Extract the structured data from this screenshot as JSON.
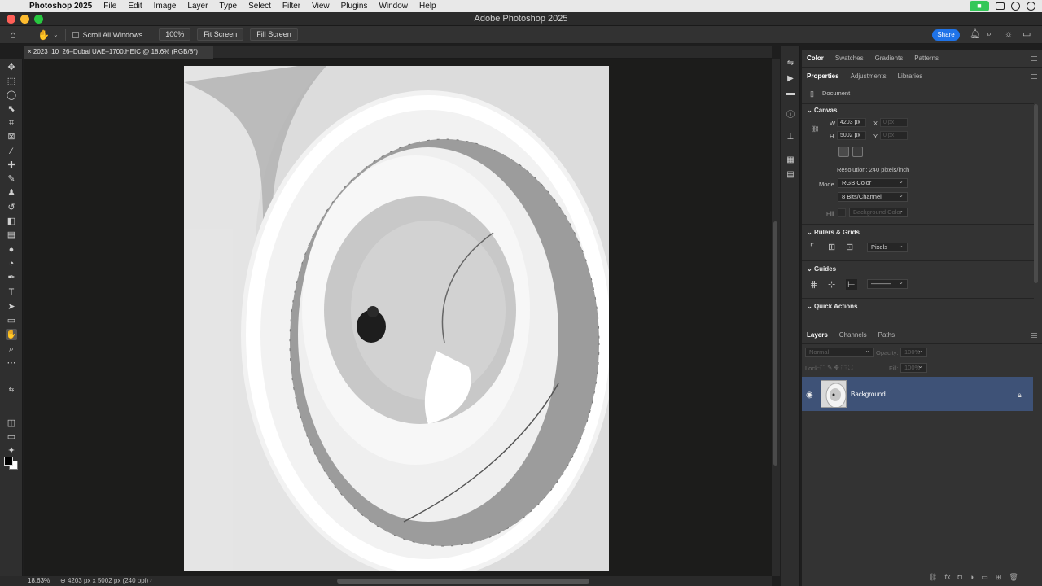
{
  "menubar": {
    "app_name": "Photoshop 2025",
    "items": [
      "File",
      "Edit",
      "Image",
      "Layer",
      "Type",
      "Select",
      "Filter",
      "View",
      "Plugins",
      "Window",
      "Help"
    ]
  },
  "window": {
    "title": "Adobe Photoshop 2025"
  },
  "options_bar": {
    "scroll_all_windows": "Scroll All Windows",
    "zoom_100": "100%",
    "fit_screen": "Fit Screen",
    "fill_screen": "Fill Screen",
    "share": "Share"
  },
  "document_tab": {
    "label": "2023_10_26–Dubai UAE–1700.HEIC @ 18.6% (RGB/8*)"
  },
  "color_panel": {
    "tabs": [
      "Color",
      "Swatches",
      "Gradients",
      "Patterns"
    ],
    "active": "Color"
  },
  "properties_panel": {
    "tabs": [
      "Properties",
      "Adjustments",
      "Libraries"
    ],
    "active": "Properties",
    "document_label": "Document",
    "canvas": {
      "title": "Canvas",
      "w_label": "W",
      "w_value": "4203 px",
      "h_label": "H",
      "h_value": "5002 px",
      "x_label": "X",
      "x_placeholder": "0 px",
      "y_label": "Y",
      "y_placeholder": "0 px",
      "resolution": "Resolution: 240 pixels/inch",
      "mode_label": "Mode",
      "mode_value": "RGB Color",
      "bits_value": "8 Bits/Channel",
      "fill_label": "Fill",
      "fill_value": "Background Color"
    },
    "rulers_grids": {
      "title": "Rulers & Grids",
      "units": "Pixels"
    },
    "guides": {
      "title": "Guides"
    },
    "quick_actions": {
      "title": "Quick Actions"
    }
  },
  "layers_panel": {
    "tabs": [
      "Layers",
      "Channels",
      "Paths"
    ],
    "active": "Layers",
    "blend_mode": "Normal",
    "opacity_label": "Opacity:",
    "opacity_value": "100%",
    "lock_label": "Lock:",
    "fill_label": "Fill:",
    "fill_value": "100%",
    "layers": [
      {
        "name": "Background",
        "locked": true,
        "visible": true,
        "selected": true
      }
    ]
  },
  "status_bar": {
    "zoom": "18.63%",
    "doc_info": "4203 px x 5002 px (240 ppi)"
  }
}
